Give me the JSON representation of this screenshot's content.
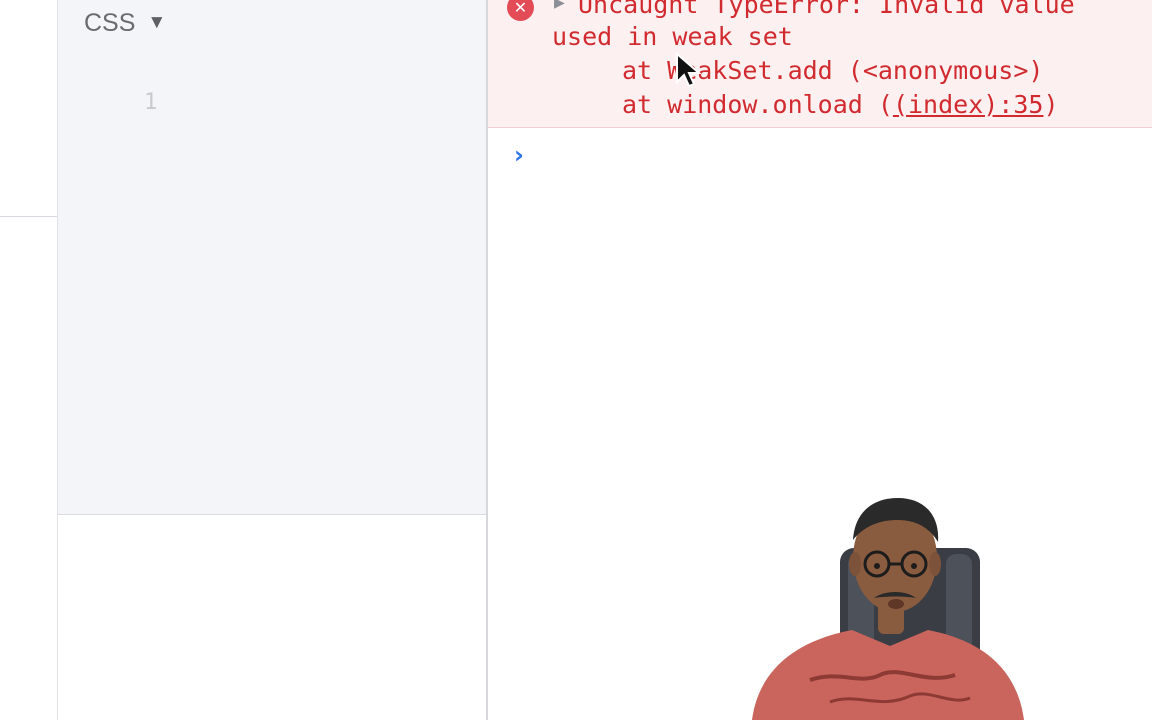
{
  "css_panel": {
    "title": "CSS",
    "caret_icon": "triangle-down-icon",
    "line_number": "1"
  },
  "console": {
    "error_icon": "error-circle-icon",
    "expand_icon": "disclosure-triangle-icon",
    "message_line1": "Uncaught TypeError: Invalid value",
    "message_line2": "used in weak set",
    "stack_line1": "at WeakSet.add (<anonymous>)",
    "stack_line2_prefix": "at window.onload (",
    "stack_line2_link": "(index):35",
    "stack_line2_suffix": ")",
    "prompt_icon": "chevron-right-icon"
  },
  "colors": {
    "error_text": "#d12b30",
    "error_background": "#fdf0f1",
    "prompt_blue": "#2a73e8",
    "editor_background": "#f4f5f9"
  }
}
